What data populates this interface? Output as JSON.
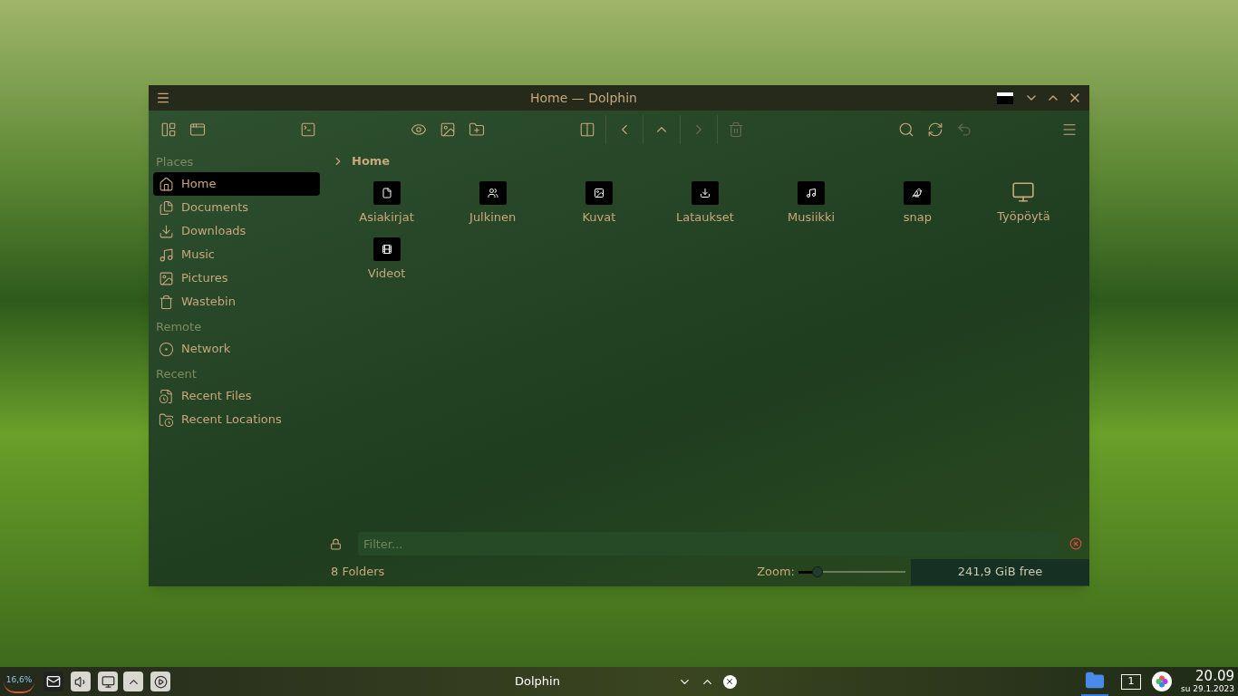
{
  "window": {
    "title": "Home — Dolphin"
  },
  "sidebar": {
    "sections": [
      {
        "heading": "Places",
        "items": [
          {
            "label": "Home",
            "kind": "home",
            "selected": true
          },
          {
            "label": "Documents",
            "kind": "documents",
            "selected": false
          },
          {
            "label": "Downloads",
            "kind": "download",
            "selected": false
          },
          {
            "label": "Music",
            "kind": "music",
            "selected": false
          },
          {
            "label": "Pictures",
            "kind": "picture",
            "selected": false
          },
          {
            "label": "Wastebin",
            "kind": "trash",
            "selected": false
          }
        ]
      },
      {
        "heading": "Remote",
        "items": [
          {
            "label": "Network",
            "kind": "network",
            "selected": false
          }
        ]
      },
      {
        "heading": "Recent",
        "items": [
          {
            "label": "Recent Files",
            "kind": "file",
            "selected": false
          },
          {
            "label": "Recent Locations",
            "kind": "location",
            "selected": false
          }
        ]
      }
    ]
  },
  "breadcrumb": [
    "Home"
  ],
  "folders": [
    {
      "name": "Asiakirjat",
      "kind": "document"
    },
    {
      "name": "Julkinen",
      "kind": "public"
    },
    {
      "name": "Kuvat",
      "kind": "image"
    },
    {
      "name": "Lataukset",
      "kind": "download"
    },
    {
      "name": "Musiikki",
      "kind": "music"
    },
    {
      "name": "snap",
      "kind": "app"
    },
    {
      "name": "Työpöytä",
      "kind": "desktop"
    },
    {
      "name": "Videot",
      "kind": "video"
    }
  ],
  "filter": {
    "placeholder": "Filter..."
  },
  "status_bar": {
    "count": "8 Folders",
    "zoom_label": "Zoom:",
    "zoom": {
      "level": 0.18
    },
    "free_space": "241,9 GiB free"
  },
  "taskbar": {
    "cpu": "16,6%",
    "task": "Dolphin",
    "desktop": "1",
    "time": "20.09",
    "date": "su 29.1.2023"
  }
}
